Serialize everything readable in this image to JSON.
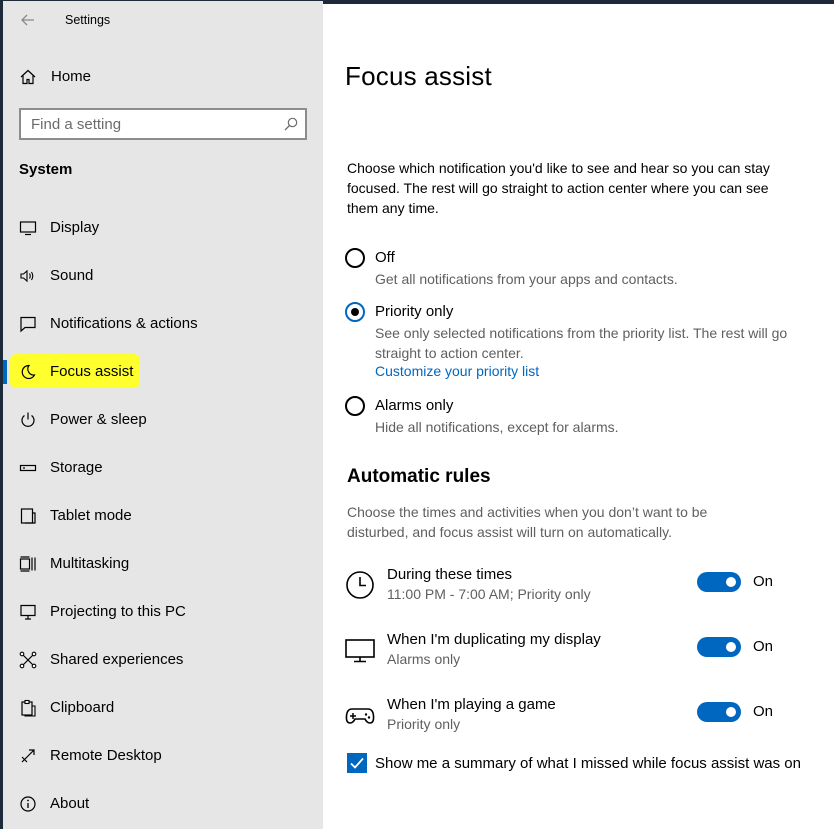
{
  "window": {
    "title": "Settings"
  },
  "sidebar": {
    "home_label": "Home",
    "search_placeholder": "Find a setting",
    "section_label": "System",
    "items": [
      {
        "label": "Display",
        "icon": "monitor-icon"
      },
      {
        "label": "Sound",
        "icon": "speaker-icon"
      },
      {
        "label": "Notifications & actions",
        "icon": "notification-icon"
      },
      {
        "label": "Focus assist",
        "icon": "moon-icon",
        "active": true
      },
      {
        "label": "Power & sleep",
        "icon": "power-icon"
      },
      {
        "label": "Storage",
        "icon": "storage-icon"
      },
      {
        "label": "Tablet mode",
        "icon": "tablet-icon"
      },
      {
        "label": "Multitasking",
        "icon": "multitasking-icon"
      },
      {
        "label": "Projecting to this PC",
        "icon": "projecting-icon"
      },
      {
        "label": "Shared experiences",
        "icon": "shared-icon"
      },
      {
        "label": "Clipboard",
        "icon": "clipboard-icon"
      },
      {
        "label": "Remote Desktop",
        "icon": "remote-desktop-icon"
      },
      {
        "label": "About",
        "icon": "info-icon"
      }
    ],
    "highlight_color": "#ffff2e",
    "accent_color": "#0067c0"
  },
  "main": {
    "title": "Focus assist",
    "description": "Choose which notification you'd like to see and hear so you can stay focused. The rest will go straight to action center where you can see them any time.",
    "options": [
      {
        "label": "Off",
        "sub": "Get all notifications from your apps and contacts.",
        "checked": false
      },
      {
        "label": "Priority only",
        "sub": "See only selected notifications from the priority list. The rest will go straight to action center.",
        "link": "Customize your priority list",
        "checked": true
      },
      {
        "label": "Alarms only",
        "sub": "Hide all notifications, except for alarms.",
        "checked": false
      }
    ],
    "rules_heading": "Automatic rules",
    "rules_description": "Choose the times and activities when you don’t want to be disturbed, and focus assist will turn on automatically.",
    "rules": [
      {
        "title": "During these times",
        "sub": "11:00 PM - 7:00 AM; Priority only",
        "toggle": "On",
        "icon": "clock-icon"
      },
      {
        "title": "When I'm duplicating my display",
        "sub": "Alarms only",
        "toggle": "On",
        "icon": "monitor-icon"
      },
      {
        "title": "When I'm playing a game",
        "sub": "Priority only",
        "toggle": "On",
        "icon": "gamepad-icon"
      }
    ],
    "summary_label": "Show me a summary of what I missed while focus assist was on",
    "summary_checked": true
  }
}
